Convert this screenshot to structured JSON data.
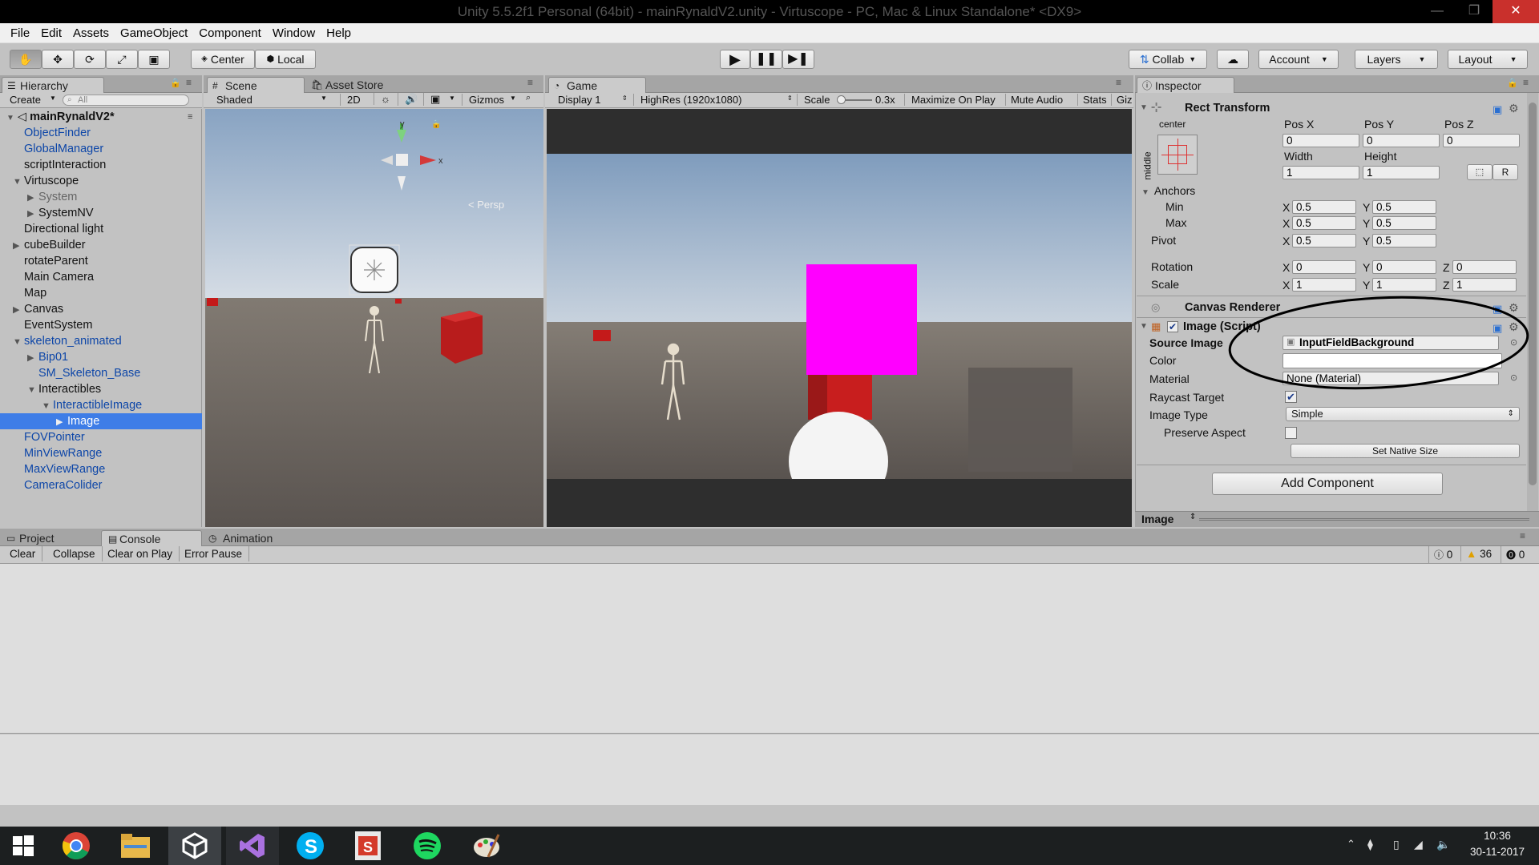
{
  "window": {
    "title": "Unity 5.5.2f1 Personal (64bit) - mainRynaldV2.unity - Virtuscope - PC, Mac & Linux Standalone* <DX9>",
    "min_icon": "minimize-icon",
    "max_icon": "maximize-icon",
    "close_icon": "close-icon"
  },
  "menu": [
    "File",
    "Edit",
    "Assets",
    "GameObject",
    "Component",
    "Window",
    "Help"
  ],
  "toolbar": {
    "center_label": "Center",
    "local_label": "Local",
    "collab_label": "Collab",
    "account_label": "Account",
    "layers_label": "Layers",
    "layout_label": "Layout"
  },
  "hierarchy": {
    "tab_label": "Hierarchy",
    "create_label": "Create",
    "search_placeholder": "All",
    "scene_name": "mainRynaldV2*",
    "items": [
      {
        "label": "ObjectFinder",
        "depth": 1,
        "prefab": true,
        "arrow": ""
      },
      {
        "label": "GlobalManager",
        "depth": 1,
        "prefab": true,
        "arrow": ""
      },
      {
        "label": "scriptInteraction",
        "depth": 1,
        "prefab": false,
        "arrow": ""
      },
      {
        "label": "Virtuscope",
        "depth": 1,
        "prefab": false,
        "arrow": "down"
      },
      {
        "label": "System",
        "depth": 2,
        "prefab": false,
        "arrow": "right",
        "dim": true
      },
      {
        "label": "SystemNV",
        "depth": 2,
        "prefab": false,
        "arrow": "right"
      },
      {
        "label": "Directional light",
        "depth": 1,
        "prefab": false,
        "arrow": ""
      },
      {
        "label": "cubeBuilder",
        "depth": 1,
        "prefab": false,
        "arrow": "right"
      },
      {
        "label": "rotateParent",
        "depth": 1,
        "prefab": false,
        "arrow": ""
      },
      {
        "label": "Main Camera",
        "depth": 1,
        "prefab": false,
        "arrow": ""
      },
      {
        "label": "Map",
        "depth": 1,
        "prefab": false,
        "arrow": ""
      },
      {
        "label": "Canvas",
        "depth": 1,
        "prefab": false,
        "arrow": "right"
      },
      {
        "label": "EventSystem",
        "depth": 1,
        "prefab": false,
        "arrow": ""
      },
      {
        "label": "skeleton_animated",
        "depth": 1,
        "prefab": true,
        "arrow": "down"
      },
      {
        "label": "Bip01",
        "depth": 2,
        "prefab": true,
        "arrow": "right"
      },
      {
        "label": "SM_Skeleton_Base",
        "depth": 2,
        "prefab": true,
        "arrow": ""
      },
      {
        "label": "Interactibles",
        "depth": 2,
        "prefab": false,
        "arrow": "down"
      },
      {
        "label": "InteractibleImage",
        "depth": 3,
        "prefab": true,
        "arrow": "down"
      },
      {
        "label": "Image",
        "depth": 4,
        "prefab": true,
        "arrow": "right",
        "selected": true
      },
      {
        "label": "FOVPointer",
        "depth": 1,
        "prefab": true,
        "arrow": ""
      },
      {
        "label": "MinViewRange",
        "depth": 1,
        "prefab": true,
        "arrow": ""
      },
      {
        "label": "MaxViewRange",
        "depth": 1,
        "prefab": true,
        "arrow": ""
      },
      {
        "label": "CameraColider",
        "depth": 1,
        "prefab": true,
        "arrow": ""
      }
    ]
  },
  "scene": {
    "tab_label": "Scene",
    "asset_store_label": "Asset Store",
    "shaded_label": "Shaded",
    "mode_2d_label": "2D",
    "gizmos_label": "Gizmos",
    "persp_label": "< Persp",
    "axis_x": "x",
    "axis_y": "y"
  },
  "game": {
    "tab_label": "Game",
    "display_label": "Display 1",
    "resolution_label": "HighRes (1920x1080)",
    "scale_label": "Scale",
    "scale_value": "0.3x",
    "maximize_label": "Maximize On Play",
    "mute_label": "Mute Audio",
    "stats_label": "Stats",
    "gizmos_label": "Giz"
  },
  "inspector": {
    "tab_label": "Inspector",
    "rect_transform_label": "Rect Transform",
    "anchor_preset_top": "center",
    "anchor_preset_side": "middle",
    "pos_x_label": "Pos X",
    "pos_y_label": "Pos Y",
    "pos_z_label": "Pos Z",
    "pos_x": "0",
    "pos_y": "0",
    "pos_z": "0",
    "width_label": "Width",
    "height_label": "Height",
    "width": "1",
    "height": "1",
    "r_label": "R",
    "anchors_label": "Anchors",
    "min_label": "Min",
    "max_label": "Max",
    "pivot_label": "Pivot",
    "anchor_min_x": "0.5",
    "anchor_min_y": "0.5",
    "anchor_max_x": "0.5",
    "anchor_max_y": "0.5",
    "pivot_x": "0.5",
    "pivot_y": "0.5",
    "rotation_label": "Rotation",
    "scale_label": "Scale",
    "rot_x": "0",
    "rot_y": "0",
    "rot_z": "0",
    "scale_x": "1",
    "scale_y": "1",
    "scale_z": "1",
    "x_label": "X",
    "y_label": "Y",
    "z_label": "Z",
    "canvas_renderer_label": "Canvas Renderer",
    "image_script_label": "Image (Script)",
    "source_image_label": "Source Image",
    "source_image_value": "InputFieldBackground",
    "color_label": "Color",
    "material_label": "Material",
    "material_value": "None (Material)",
    "raycast_label": "Raycast Target",
    "raycast_checked": true,
    "image_type_label": "Image Type",
    "image_type_value": "Simple",
    "preserve_aspect_label": "Preserve Aspect",
    "set_native_size_label": "Set Native Size",
    "add_component_label": "Add Component",
    "preview_label": "Image"
  },
  "bottom": {
    "project_tab": "Project",
    "console_tab": "Console",
    "animation_tab": "Animation",
    "clear_label": "Clear",
    "collapse_label": "Collapse",
    "clear_on_play_label": "Clear on Play",
    "error_pause_label": "Error Pause",
    "info_count": "0",
    "warning_count": "36",
    "error_count": "0"
  },
  "taskbar": {
    "apps": [
      "windows-start-icon",
      "chrome-icon",
      "file-explorer-icon",
      "unity-icon",
      "visual-studio-icon",
      "skype-icon",
      "slides-icon",
      "spotify-icon",
      "paint-icon"
    ],
    "time": "10:36",
    "date": "30-11-2017"
  },
  "colors": {
    "unity_gray": "#c2c2c2",
    "selection_blue": "#3e7de7",
    "prefab_blue": "#0d46a8",
    "magenta": "#ff00ff",
    "cube_red": "#c41a1a"
  }
}
